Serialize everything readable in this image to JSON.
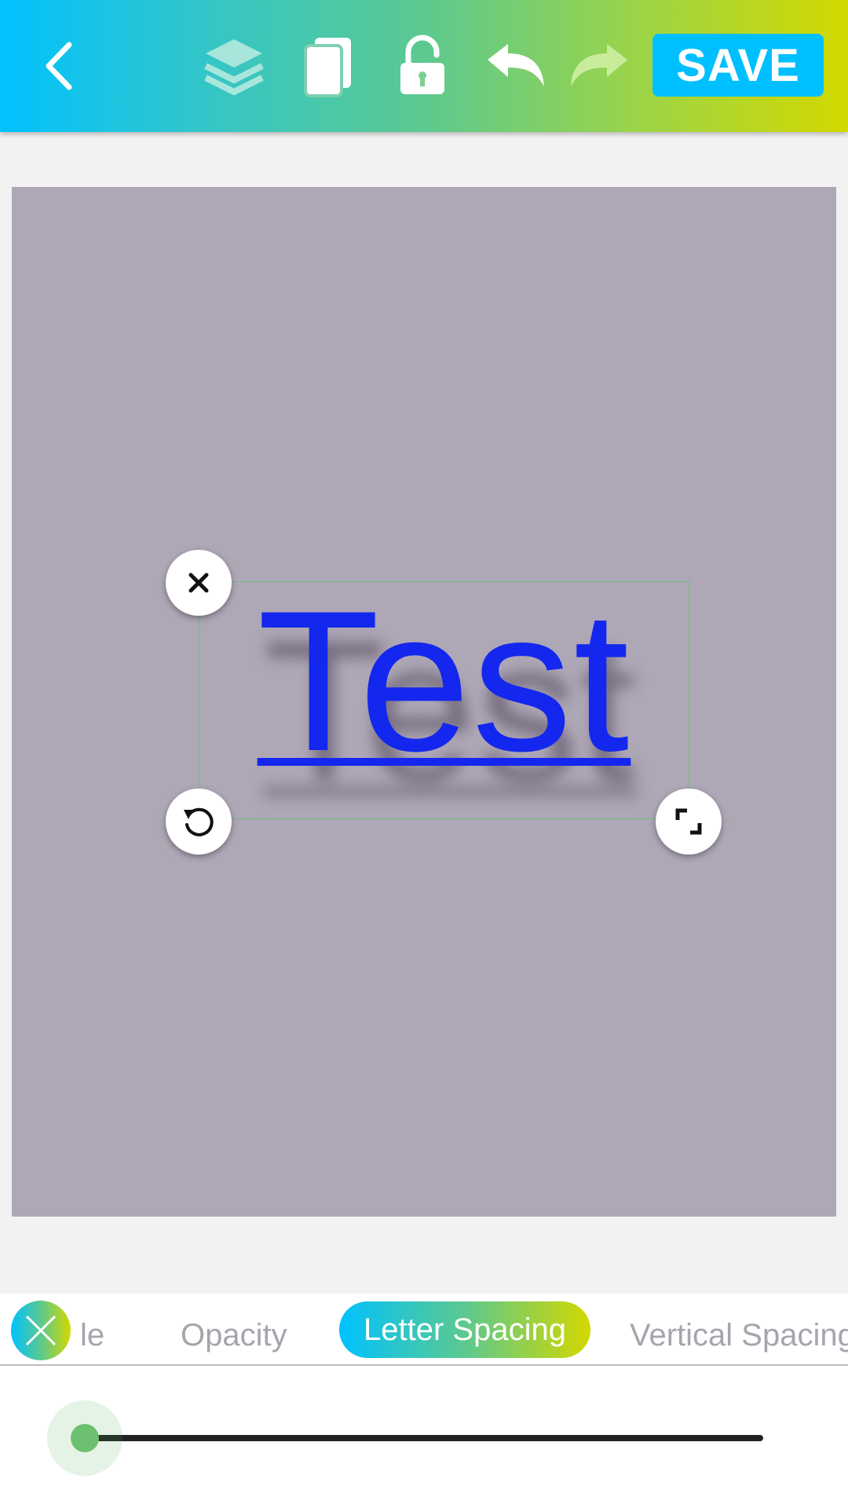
{
  "toolbar": {
    "icons": [
      "back-icon",
      "layers-icon",
      "duplicate-icon",
      "unlock-icon",
      "undo-icon",
      "redo-icon"
    ],
    "save_label": "SAVE"
  },
  "canvas": {
    "background": "#aea7b6",
    "text": "Test",
    "text_color": "#1427ee"
  },
  "tabs": {
    "partial_label": "le",
    "items": [
      "Opacity",
      "Letter Spacing",
      "Vertical Spacing"
    ],
    "active": "Letter Spacing"
  },
  "slider": {
    "value_fraction": 0.0,
    "accent": "#6cc070"
  },
  "colors": {
    "gradient": [
      "#00c2ff",
      "#5cc98f",
      "#d3d800"
    ],
    "save_button": "#00bfff"
  }
}
